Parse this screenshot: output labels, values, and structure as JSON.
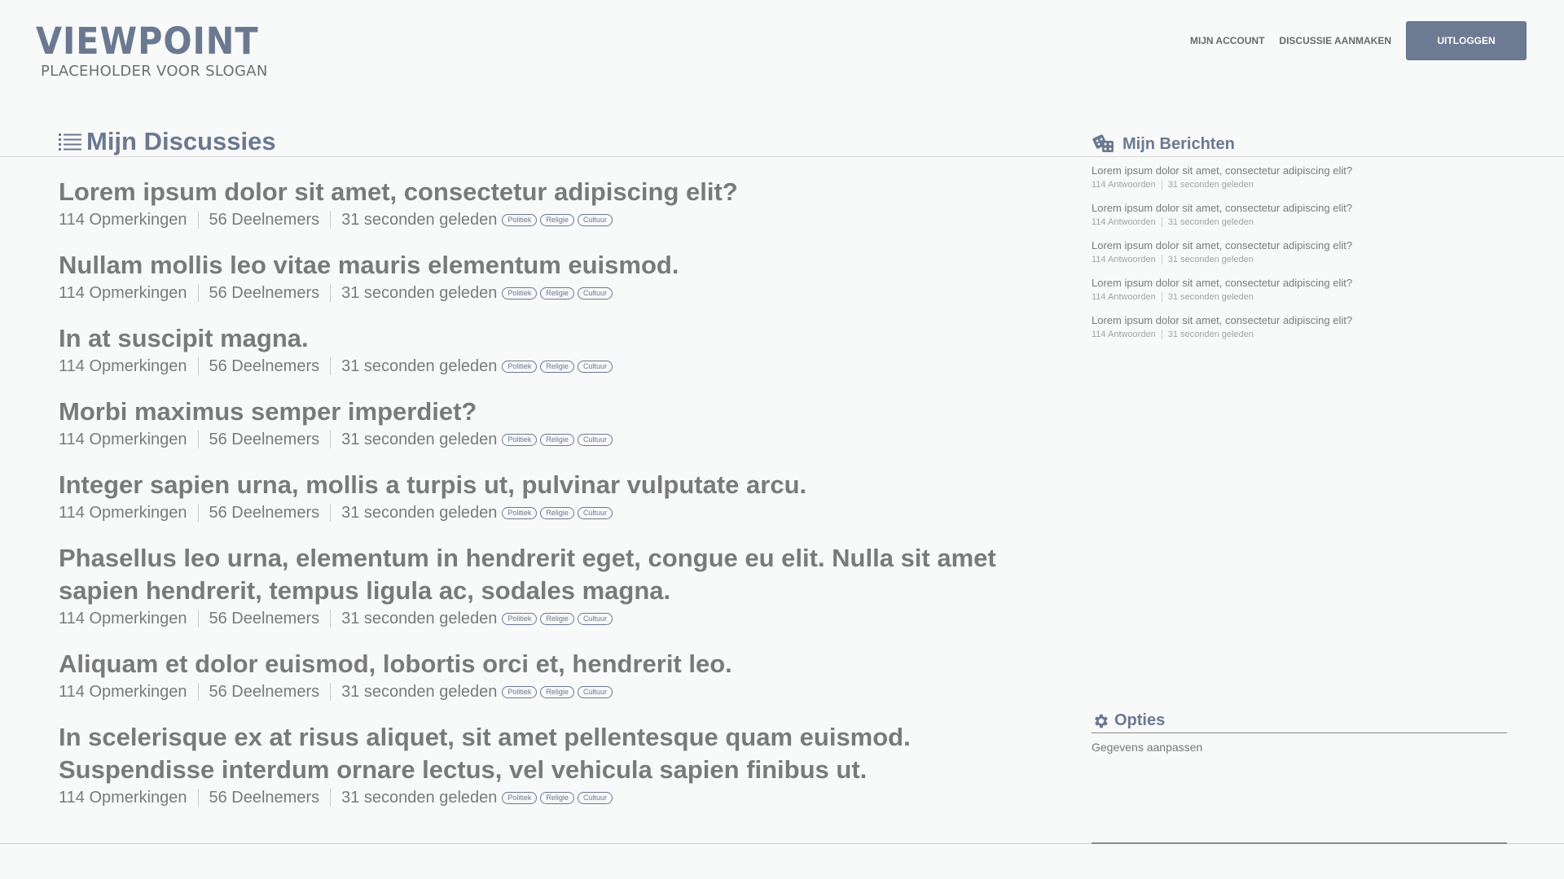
{
  "header": {
    "logo": "VIEWPOINT",
    "slogan": "PLACEHOLDER VOOR SLOGAN",
    "nav": {
      "account": "MIJN ACCOUNT",
      "create": "DISCUSSIE AANMAKEN",
      "logout": "UITLOGGEN"
    }
  },
  "main": {
    "title": "Mijn Discussies",
    "discussions": [
      {
        "title": "Lorem ipsum dolor sit amet, consectetur adipiscing elit?",
        "comments": "114 Opmerkingen",
        "participants": "56 Deelnemers",
        "time": "31 seconden geleden",
        "tags": [
          "Politiek",
          "Religie",
          "Cultuur"
        ]
      },
      {
        "title": "Nullam mollis leo vitae mauris elementum euismod.",
        "comments": "114 Opmerkingen",
        "participants": "56 Deelnemers",
        "time": "31 seconden geleden",
        "tags": [
          "Politiek",
          "Religie",
          "Cultuur"
        ]
      },
      {
        "title": "In at suscipit magna.",
        "comments": "114 Opmerkingen",
        "participants": "56 Deelnemers",
        "time": "31 seconden geleden",
        "tags": [
          "Politiek",
          "Religie",
          "Cultuur"
        ]
      },
      {
        "title": "Morbi maximus semper imperdiet?",
        "comments": "114 Opmerkingen",
        "participants": "56 Deelnemers",
        "time": "31 seconden geleden",
        "tags": [
          "Politiek",
          "Religie",
          "Cultuur"
        ]
      },
      {
        "title": "Integer sapien urna, mollis a turpis ut, pulvinar vulputate arcu.",
        "comments": "114 Opmerkingen",
        "participants": "56 Deelnemers",
        "time": "31 seconden geleden",
        "tags": [
          "Politiek",
          "Religie",
          "Cultuur"
        ]
      },
      {
        "title": "Phasellus leo urna, elementum in hendrerit eget, congue eu elit. Nulla sit amet sapien hendrerit, tempus ligula ac, sodales magna.",
        "comments": "114 Opmerkingen",
        "participants": "56 Deelnemers",
        "time": "31 seconden geleden",
        "tags": [
          "Politiek",
          "Religie",
          "Cultuur"
        ]
      },
      {
        "title": "Aliquam et dolor euismod, lobortis orci et, hendrerit leo.",
        "comments": "114 Opmerkingen",
        "participants": "56 Deelnemers",
        "time": "31 seconden geleden",
        "tags": [
          "Politiek",
          "Religie",
          "Cultuur"
        ]
      },
      {
        "title": "In scelerisque ex at risus aliquet, sit amet pellentesque quam euismod. Suspendisse interdum ornare lectus, vel vehicula sapien finibus ut.",
        "comments": "114 Opmerkingen",
        "participants": "56 Deelnemers",
        "time": "31 seconden geleden",
        "tags": [
          "Politiek",
          "Religie",
          "Cultuur"
        ]
      }
    ]
  },
  "sidebar": {
    "messages_title": "Mijn Berichten",
    "messages": [
      {
        "title": "Lorem ipsum dolor sit amet, consectetur adipiscing elit?",
        "answers": "114 Antwoorden",
        "time": "31 seconden geleden"
      },
      {
        "title": "Lorem ipsum dolor sit amet, consectetur adipiscing elit?",
        "answers": "114 Antwoorden",
        "time": "31 seconden geleden"
      },
      {
        "title": "Lorem ipsum dolor sit amet, consectetur adipiscing elit?",
        "answers": "114 Antwoorden",
        "time": "31 seconden geleden"
      },
      {
        "title": "Lorem ipsum dolor sit amet, consectetur adipiscing elit?",
        "answers": "114 Antwoorden",
        "time": "31 seconden geleden"
      },
      {
        "title": "Lorem ipsum dolor sit amet, consectetur adipiscing elit?",
        "answers": "114 Antwoorden",
        "time": "31 seconden geleden"
      }
    ],
    "options_title": "Opties",
    "options_link": "Gegevens aanpassen"
  },
  "icons": {
    "main_title": "list-icon",
    "messages_title": "dice-icon",
    "options_title": "gear-icon"
  },
  "colors": {
    "accent": "#6a7991",
    "text": "#7a7a7a",
    "background": "#f8f9f9"
  }
}
